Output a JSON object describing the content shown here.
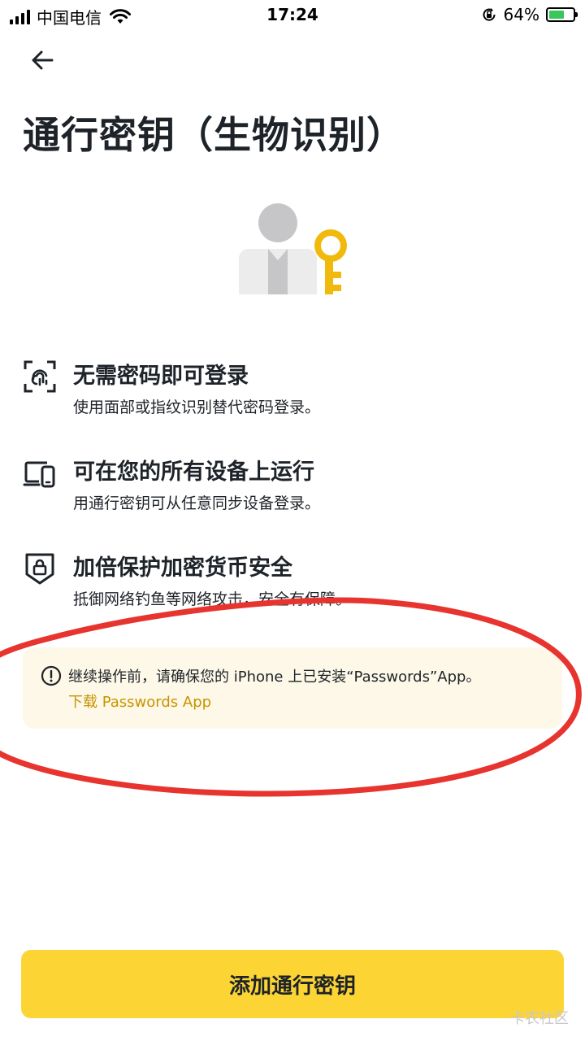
{
  "status_bar": {
    "carrier": "中国电信",
    "time": "17:24",
    "battery_pct": "64%",
    "battery_level": 0.64,
    "battery_color": "#38c759"
  },
  "header": {
    "back_icon": "arrow-left-icon"
  },
  "title": "通行密钥（生物识别）",
  "illustration_icon": "user-with-key-icon",
  "features": [
    {
      "icon": "fingerprint-scan-icon",
      "heading": "无需密码即可登录",
      "description": "使用面部或指纹识别替代密码登录。"
    },
    {
      "icon": "devices-icon",
      "heading": "可在您的所有设备上运行",
      "description": "用通行密钥可从任意同步设备登录。"
    },
    {
      "icon": "shield-lock-icon",
      "heading": "加倍保护加密货币安全",
      "description": "抵御网络钓鱼等网络攻击，安全有保障。"
    }
  ],
  "notice": {
    "icon": "info-circle-icon",
    "text": "继续操作前，请确保您的 iPhone 上已安装“Passwords”App。",
    "link": "下载 Passwords App",
    "link_color": "#c99400",
    "background": "#fdf8e8"
  },
  "primary_button": {
    "label": "添加通行密钥",
    "color": "#fcd535"
  },
  "accent_key_color": "#f0b90b",
  "annotation_color": "#e8342e",
  "watermark": "卡农社区"
}
